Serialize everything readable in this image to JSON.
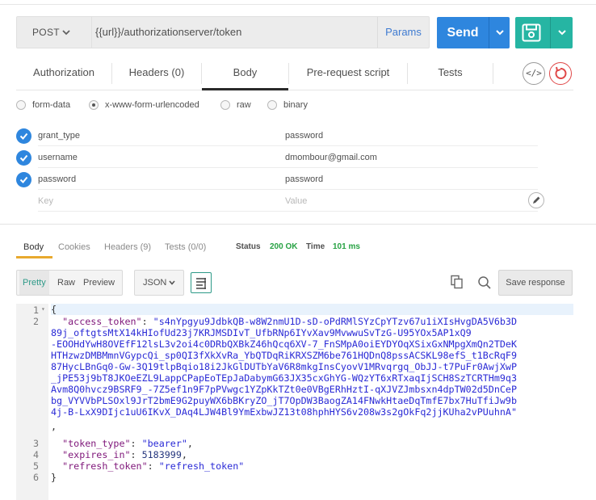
{
  "request": {
    "method": "POST",
    "url": "{{url}}/authorizationserver/token",
    "params_label": "Params",
    "send_label": "Send"
  },
  "tabs": [
    {
      "label": "Authorization"
    },
    {
      "label": "Headers (0)"
    },
    {
      "label": "Body"
    },
    {
      "label": "Pre-request script"
    },
    {
      "label": "Tests"
    }
  ],
  "code_button_label": "</>",
  "body_types": [
    {
      "label": "form-data",
      "selected": false
    },
    {
      "label": "x-www-form-urlencoded",
      "selected": true
    },
    {
      "label": "raw",
      "selected": false
    },
    {
      "label": "binary",
      "selected": false
    }
  ],
  "params": [
    {
      "key": "grant_type",
      "value": "password"
    },
    {
      "key": "username",
      "value": "dmombour@gmail.com"
    },
    {
      "key": "password",
      "value": "password"
    }
  ],
  "new_param": {
    "key_placeholder": "Key",
    "value_placeholder": "Value"
  },
  "response": {
    "tabs": [
      {
        "label": "Body"
      },
      {
        "label": "Cookies"
      },
      {
        "label": "Headers (9)"
      },
      {
        "label": "Tests (0/0)"
      }
    ],
    "status_label": "Status",
    "status_value": "200 OK",
    "time_label": "Time",
    "time_value": "101 ms",
    "formats": {
      "pretty": "Pretty",
      "raw": "Raw",
      "preview": "Preview"
    },
    "language": "JSON",
    "save_label": "Save response",
    "lines": [
      {
        "num": "1",
        "fold": "▾",
        "text": "{"
      },
      {
        "num": "2",
        "key": "\"access_token\"",
        "value": "\"s4nYpgyu9JdbkQB-w8W2nmU1D-sD-oPdRMlSYzCpYTzv67u1iXIsHvgDA5V6b3D"
      },
      {
        "cont": "89j_oftgtsMtX14kHIofUd23j7KRJMSDIvT_UfbRNp6IYvXav9MvwwuSvTzG-U95YOx5AP1xQ9"
      },
      {
        "cont": "-EOOHdYwH8OVEfF12lsL3v2oi4c0DRbQXBkZ46hQcq6XV-7_FnSMpA0oiEYDYOqXSixGxNMpgXmQn2TDeK"
      },
      {
        "cont": "HTHzwzDMBMmnVGypcQi_sp0QI3fXkXvRa_YbQTDqRiKRXSZM6be761HQDnQ8pssACSKL98efS_t1BcRqF9"
      },
      {
        "cont": "87HycLBnGq0-Gw-3Q19tlpBqio18i2JkGlDUTbYaV6R8mkgInsCyovV1MRvqrgq_ObJJ-t7PuFr0AwjXwP"
      },
      {
        "cont": "_jPE53j9bT8JKOeEZL9LappCPapEoTEpJaDabymG63JX35cxGhYG-WQzYT6xRTxaqIjSCH8SzTCRTHm9q3"
      },
      {
        "cont": "Avm8Q0hvcz9BSRF9_-7Z5ef1n9F7pPVwgc1YZpKkTZt0e0VBgERhHztI-qXJVZJmbsxn4dpTW02d5DnCeP"
      },
      {
        "cont": "bg_VYVVbPLSOxl9JrT2bmE9G2puyWX6bBKryZO_jT7OpDW3BaogZA14FNwkHtaeDqTmfE7bx7HuTfiJw9b"
      },
      {
        "cont": "4j-B-LxX9DIjc1uU6IKvX_DAq4LJW4Bl9YmExbwJZ13t08hphHYS6v208w3s2gOkFq2jjKUha2vPUuhnA\""
      },
      {
        "cont_punct": ","
      },
      {
        "num": "3",
        "key": "\"token_type\"",
        "value": "\"bearer\"",
        "trail": ","
      },
      {
        "num": "4",
        "key": "\"expires_in\"",
        "value_num": "5183999",
        "trail": ","
      },
      {
        "num": "5",
        "key": "\"refresh_token\"",
        "value": "\"refresh_token\""
      },
      {
        "num": "6",
        "text": "}"
      }
    ]
  }
}
